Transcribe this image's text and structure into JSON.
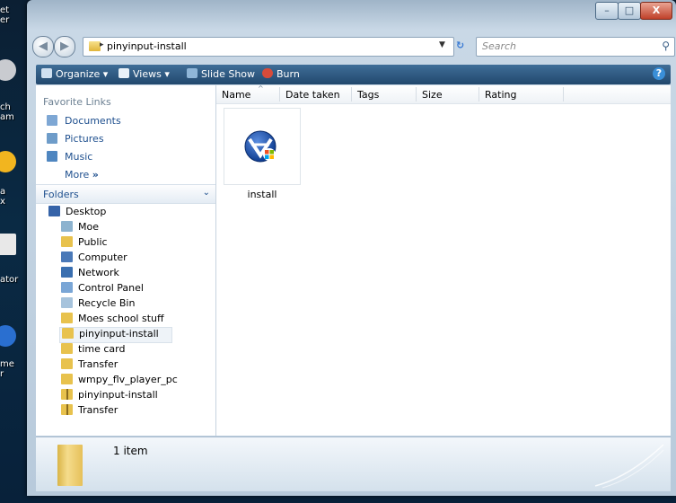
{
  "desktop": {
    "labels": [
      "et\ner",
      "ch\nam",
      "a\nx",
      "ator",
      "me\nr"
    ]
  },
  "window": {
    "controls": {
      "minimize": "–",
      "maximize": "□",
      "close": "X"
    }
  },
  "address": {
    "back": "◀",
    "forward": "▶",
    "path": "pinyinput-install",
    "search_placeholder": "Search"
  },
  "toolbar": {
    "organize": "Organize",
    "views": "Views",
    "slideshow": "Slide Show",
    "burn": "Burn",
    "help": "?"
  },
  "nav": {
    "favorite_links_header": "Favorite Links",
    "links": [
      "Documents",
      "Pictures",
      "Music"
    ],
    "more": "More",
    "folders_header": "Folders",
    "tree": [
      "Desktop",
      "Moe",
      "Public",
      "Computer",
      "Network",
      "Control Panel",
      "Recycle Bin",
      "Moes school stuff",
      "pinyinput-install",
      "time card",
      "Transfer",
      "wmpy_flv_player_pc",
      "pinyinput-install",
      "Transfer"
    ]
  },
  "content": {
    "columns": [
      "Name",
      "Date taken",
      "Tags",
      "Size",
      "Rating"
    ],
    "items": [
      {
        "label": "install"
      }
    ]
  },
  "details": {
    "count": "1 item"
  }
}
